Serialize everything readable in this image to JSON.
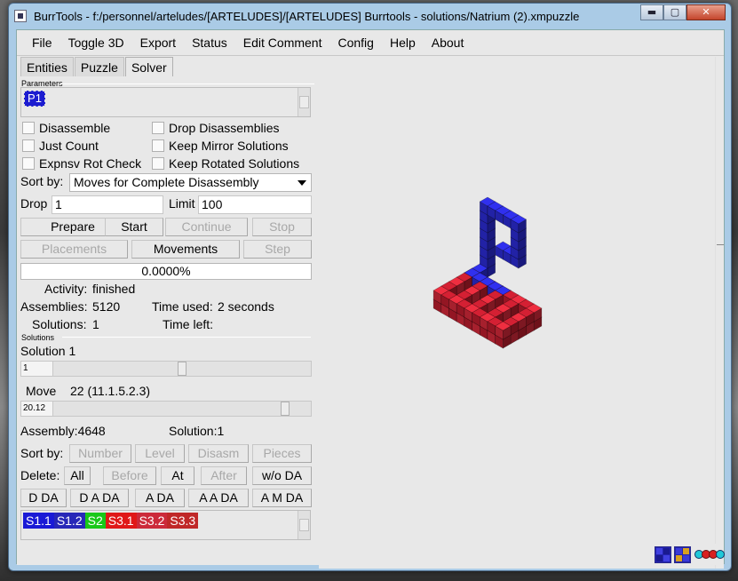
{
  "window": {
    "title": "BurrTools - f:/personnel/arteludes/[ARTELUDES]/[ARTELUDES] Burrtools - solutions/Natrium (2).xmpuzzle",
    "minimize": "▬",
    "maximize": "▢",
    "close": "✕"
  },
  "menu": [
    "File",
    "Toggle 3D",
    "Export",
    "Status",
    "Edit Comment",
    "Config",
    "Help",
    "About"
  ],
  "tabs": [
    "Entities",
    "Puzzle",
    "Solver"
  ],
  "active_tab": "Solver",
  "parameters": {
    "group_title": "Parameters",
    "selected": "P1"
  },
  "options": {
    "disassemble": "Disassemble",
    "drop_disassemblies": "Drop Disassemblies",
    "just_count": "Just Count",
    "keep_mirror": "Keep Mirror Solutions",
    "expnsv_rot_check": "Expnsv Rot Check",
    "keep_rotated": "Keep Rotated Solutions"
  },
  "sort_by": {
    "label": "Sort by:",
    "value": "Moves for Complete Disassembly"
  },
  "drop": {
    "label": "Drop",
    "value": "1"
  },
  "limit": {
    "label": "Limit",
    "value": "100"
  },
  "buttons_row1": {
    "prepare": "Prepare",
    "start": "Start",
    "continue": "Continue",
    "stop": "Stop"
  },
  "buttons_row2": {
    "placements": "Placements",
    "movements": "Movements",
    "step": "Step"
  },
  "progress": {
    "text": "0.0000%",
    "fraction": 0.0
  },
  "status": {
    "activity_label": "Activity:",
    "activity_value": "finished",
    "assemblies_label": "Assemblies:",
    "assemblies_value": "5120",
    "time_used_label": "Time used:",
    "time_used_value": "2 seconds",
    "solutions_label": "Solutions:",
    "solutions_value": "1",
    "time_left_label": "Time left:",
    "time_left_value": ""
  },
  "solutions": {
    "group_title": "Solutions",
    "solution_label": "Solution 1",
    "solution_slider_value": "1",
    "move_label": "Move",
    "move_value": "22 (11.1.5.2.3)",
    "move_slider_value": "20.12",
    "assembly_info": "Assembly:4648",
    "solution_info": "Solution:1"
  },
  "sort_row": {
    "label": "Sort by:",
    "number": "Number",
    "level": "Level",
    "disasm": "Disasm",
    "pieces": "Pieces"
  },
  "delete_row": {
    "label": "Delete:",
    "all": "All",
    "before": "Before",
    "at": "At",
    "after": "After",
    "wo_da": "w/o DA"
  },
  "da_row": {
    "d_da": "D DA",
    "d_a_da": "D A DA",
    "a_da": "A DA",
    "a_a_da": "A A DA",
    "a_m_da": "A M DA"
  },
  "pieces": [
    {
      "label": "S1.1",
      "color": "#1a1ad6"
    },
    {
      "label": "S1.2",
      "color": "#2828b8"
    },
    {
      "label": "S2",
      "color": "#18c818"
    },
    {
      "label": "S3.1",
      "color": "#e01818"
    },
    {
      "label": "S3.2",
      "color": "#cc2a3a"
    },
    {
      "label": "S3.3",
      "color": "#c02828"
    }
  ],
  "status_icons": [
    "blue-grid-icon",
    "color-grid-icon",
    "spheres-icon"
  ]
}
